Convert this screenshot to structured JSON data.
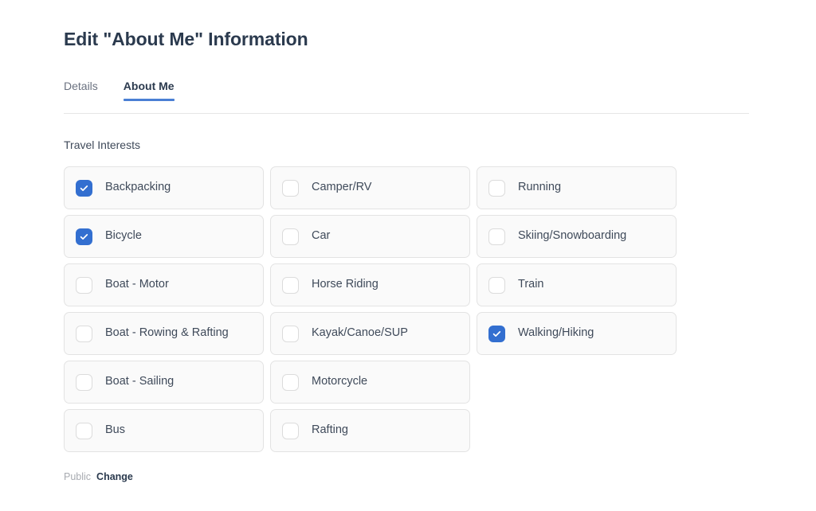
{
  "page": {
    "title": "Edit \"About Me\" Information"
  },
  "tabs": [
    {
      "label": "Details",
      "active": false
    },
    {
      "label": "About Me",
      "active": true
    }
  ],
  "section": {
    "label": "Travel Interests"
  },
  "options": [
    {
      "label": "Backpacking",
      "checked": true
    },
    {
      "label": "Bicycle",
      "checked": true
    },
    {
      "label": "Boat - Motor",
      "checked": false
    },
    {
      "label": "Boat - Rowing & Rafting",
      "checked": false
    },
    {
      "label": "Boat - Sailing",
      "checked": false
    },
    {
      "label": "Bus",
      "checked": false
    },
    {
      "label": "Camper/RV",
      "checked": false
    },
    {
      "label": "Car",
      "checked": false
    },
    {
      "label": "Horse Riding",
      "checked": false
    },
    {
      "label": "Kayak/Canoe/SUP",
      "checked": false
    },
    {
      "label": "Motorcycle",
      "checked": false
    },
    {
      "label": "Rafting",
      "checked": false
    },
    {
      "label": "Running",
      "checked": false
    },
    {
      "label": "Skiing/Snowboarding",
      "checked": false
    },
    {
      "label": "Train",
      "checked": false
    },
    {
      "label": "Walking/Hiking",
      "checked": true
    }
  ],
  "visibility": {
    "state": "Public",
    "change_label": "Change"
  },
  "colors": {
    "accent": "#336fd0",
    "tab_underline": "#4a7fd4",
    "title": "#2b3a4e",
    "card_bg": "#fafafa",
    "card_border": "#e3e3e3",
    "muted": "#a8abb1"
  }
}
